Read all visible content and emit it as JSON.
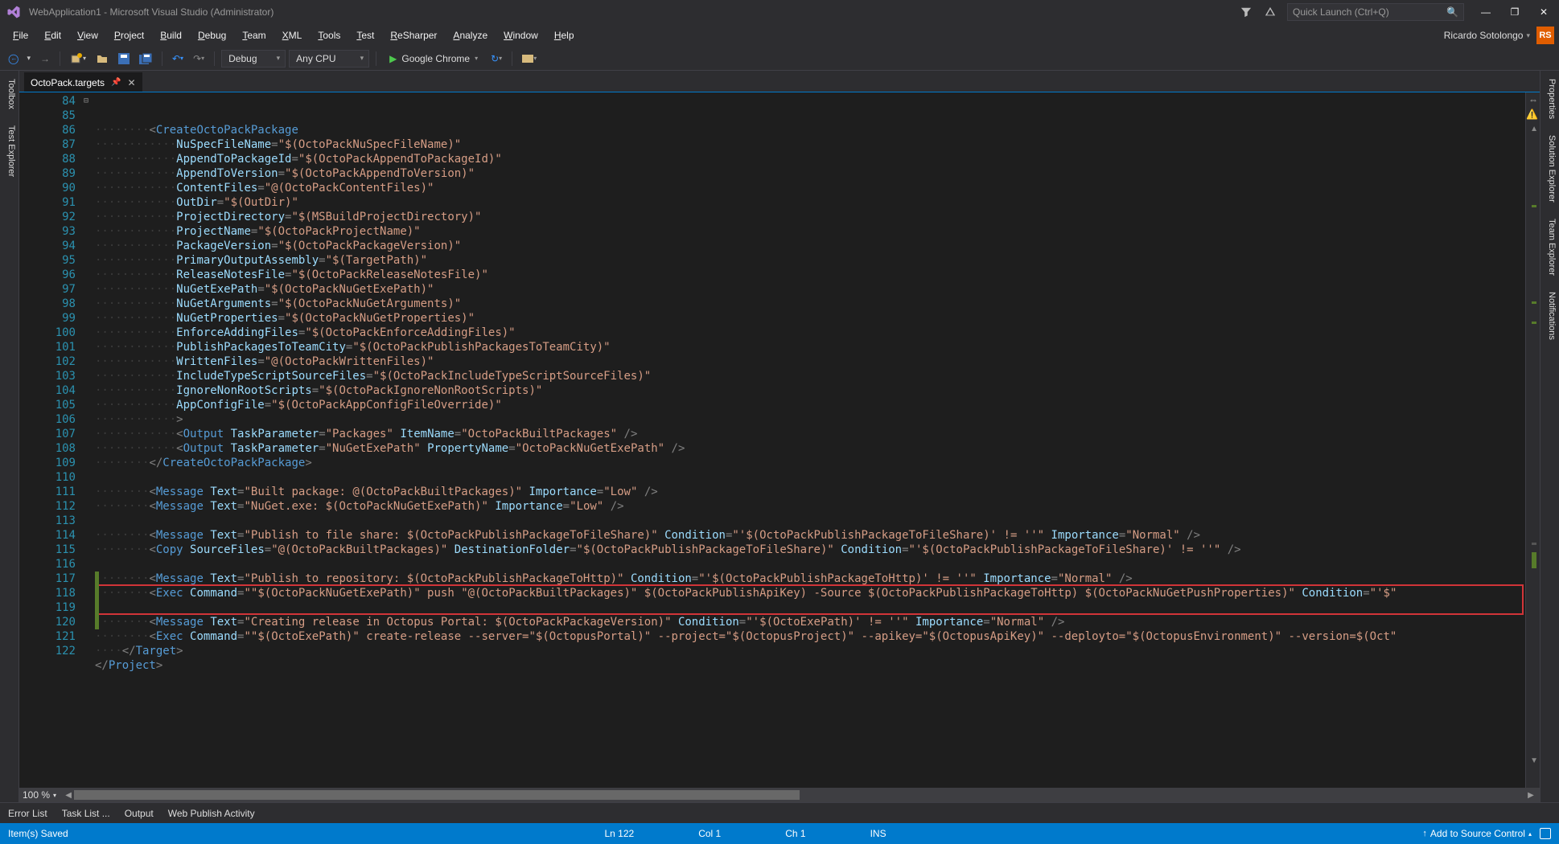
{
  "title": "WebApplication1 - Microsoft Visual Studio  (Administrator)",
  "quick_launch_placeholder": "Quick Launch (Ctrl+Q)",
  "menus": [
    "File",
    "Edit",
    "View",
    "Project",
    "Build",
    "Debug",
    "Team",
    "XML",
    "Tools",
    "Test",
    "ReSharper",
    "Analyze",
    "Window",
    "Help"
  ],
  "user_name": "Ricardo Sotolongo",
  "user_initials": "RS",
  "toolbar": {
    "config": "Debug",
    "platform": "Any CPU",
    "start_label": "Google Chrome"
  },
  "left_tabs": [
    "Toolbox",
    "Test Explorer"
  ],
  "right_tabs": [
    "Properties",
    "Solution Explorer",
    "Team Explorer",
    "Notifications"
  ],
  "doc_tab": "OctoPack.targets",
  "zoom": "100 %",
  "bottom_tabs": [
    "Error List",
    "Task List ...",
    "Output",
    "Web Publish Activity"
  ],
  "status": {
    "left": "Item(s) Saved",
    "ln": "Ln 122",
    "col": "Col 1",
    "ch": "Ch 1",
    "ins": "INS",
    "scc": "Add to Source Control"
  },
  "line_start": 84,
  "code_lines": [
    {
      "indent": 2,
      "type": "open_partial",
      "el": "CreateOctoPackPackage"
    },
    {
      "indent": 3,
      "type": "attr",
      "name": "NuSpecFileName",
      "val": "$(OctoPackNuSpecFileName)"
    },
    {
      "indent": 3,
      "type": "attr",
      "name": "AppendToPackageId",
      "val": "$(OctoPackAppendToPackageId)"
    },
    {
      "indent": 3,
      "type": "attr",
      "name": "AppendToVersion",
      "val": "$(OctoPackAppendToVersion)"
    },
    {
      "indent": 3,
      "type": "attr",
      "name": "ContentFiles",
      "val": "@(OctoPackContentFiles)"
    },
    {
      "indent": 3,
      "type": "attr",
      "name": "OutDir",
      "val": "$(OutDir)"
    },
    {
      "indent": 3,
      "type": "attr",
      "name": "ProjectDirectory",
      "val": "$(MSBuildProjectDirectory)"
    },
    {
      "indent": 3,
      "type": "attr",
      "name": "ProjectName",
      "val": "$(OctoPackProjectName)"
    },
    {
      "indent": 3,
      "type": "attr",
      "name": "PackageVersion",
      "val": "$(OctoPackPackageVersion)"
    },
    {
      "indent": 3,
      "type": "attr",
      "name": "PrimaryOutputAssembly",
      "val": "$(TargetPath)"
    },
    {
      "indent": 3,
      "type": "attr",
      "name": "ReleaseNotesFile",
      "val": "$(OctoPackReleaseNotesFile)"
    },
    {
      "indent": 3,
      "type": "attr",
      "name": "NuGetExePath",
      "val": "$(OctoPackNuGetExePath)"
    },
    {
      "indent": 3,
      "type": "attr",
      "name": "NuGetArguments",
      "val": "$(OctoPackNuGetArguments)"
    },
    {
      "indent": 3,
      "type": "attr",
      "name": "NuGetProperties",
      "val": "$(OctoPackNuGetProperties)"
    },
    {
      "indent": 3,
      "type": "attr",
      "name": "EnforceAddingFiles",
      "val": "$(OctoPackEnforceAddingFiles)"
    },
    {
      "indent": 3,
      "type": "attr",
      "name": "PublishPackagesToTeamCity",
      "val": "$(OctoPackPublishPackagesToTeamCity)"
    },
    {
      "indent": 3,
      "type": "attr",
      "name": "WrittenFiles",
      "val": "@(OctoPackWrittenFiles)"
    },
    {
      "indent": 3,
      "type": "attr",
      "name": "IncludeTypeScriptSourceFiles",
      "val": "$(OctoPackIncludeTypeScriptSourceFiles)"
    },
    {
      "indent": 3,
      "type": "attr",
      "name": "IgnoreNonRootScripts",
      "val": "$(OctoPackIgnoreNonRootScripts)"
    },
    {
      "indent": 3,
      "type": "attr",
      "name": "AppConfigFile",
      "val": "$(OctoPackAppConfigFileOverride)"
    },
    {
      "indent": 3,
      "type": "close_angle"
    },
    {
      "indent": 3,
      "type": "tag",
      "el": "Output",
      "attrs": [
        [
          "TaskParameter",
          "Packages"
        ],
        [
          "ItemName",
          "OctoPackBuiltPackages"
        ]
      ],
      "self": true
    },
    {
      "indent": 3,
      "type": "tag",
      "el": "Output",
      "attrs": [
        [
          "TaskParameter",
          "NuGetExePath"
        ],
        [
          "PropertyName",
          "OctoPackNuGetExePath"
        ]
      ],
      "self": true
    },
    {
      "indent": 2,
      "type": "end",
      "el": "CreateOctoPackPackage"
    },
    {
      "indent": 0,
      "type": "blank"
    },
    {
      "indent": 2,
      "type": "tag",
      "el": "Message",
      "attrs": [
        [
          "Text",
          "Built package: @(OctoPackBuiltPackages)"
        ],
        [
          "Importance",
          "Low"
        ]
      ],
      "self": true
    },
    {
      "indent": 2,
      "type": "tag",
      "el": "Message",
      "attrs": [
        [
          "Text",
          "NuGet.exe: $(OctoPackNuGetExePath)"
        ],
        [
          "Importance",
          "Low"
        ]
      ],
      "self": true
    },
    {
      "indent": 0,
      "type": "blank"
    },
    {
      "indent": 2,
      "type": "tag",
      "el": "Message",
      "attrs": [
        [
          "Text",
          "Publish to file share: $(OctoPackPublishPackageToFileShare)"
        ],
        [
          "Condition",
          "'$(OctoPackPublishPackageToFileShare)' != ''"
        ],
        [
          "Importance",
          "Normal"
        ]
      ],
      "self": true
    },
    {
      "indent": 2,
      "type": "tag",
      "el": "Copy",
      "attrs": [
        [
          "SourceFiles",
          "@(OctoPackBuiltPackages)"
        ],
        [
          "DestinationFolder",
          "$(OctoPackPublishPackageToFileShare)"
        ],
        [
          "Condition",
          "'$(OctoPackPublishPackageToFileShare)' != ''"
        ]
      ],
      "self": true
    },
    {
      "indent": 0,
      "type": "blank"
    },
    {
      "indent": 2,
      "type": "tag",
      "el": "Message",
      "attrs": [
        [
          "Text",
          "Publish to repository: $(OctoPackPublishPackageToHttp)"
        ],
        [
          "Condition",
          "'$(OctoPackPublishPackageToHttp)' != ''"
        ],
        [
          "Importance",
          "Normal"
        ]
      ],
      "self": true
    },
    {
      "indent": 2,
      "type": "tag",
      "el": "Exec",
      "attrs": [
        [
          "Command",
          "\"$(OctoPackNuGetExePath)\" push \"@(OctoPackBuiltPackages)\" $(OctoPackPublishApiKey) -Source $(OctoPackPublishPackageToHttp) $(OctoPackNuGetPushProperties)"
        ],
        [
          "Condition",
          "'$"
        ]
      ],
      "self": false,
      "trunc": true
    },
    {
      "indent": 0,
      "type": "blank"
    },
    {
      "indent": 2,
      "type": "tag",
      "el": "Message",
      "attrs": [
        [
          "Text",
          "Creating release in Octopus Portal: $(OctoPackPackageVersion)"
        ],
        [
          "Condition",
          "'$(OctoExePath)' != ''"
        ],
        [
          "Importance",
          "Normal"
        ]
      ],
      "self": true
    },
    {
      "indent": 2,
      "type": "tag",
      "el": "Exec",
      "attrs": [
        [
          "Command",
          "\"$(OctoExePath)\" create-release --server=\"$(OctopusPortal)\" --project=\"$(OctopusProject)\" --apikey=\"$(OctopusApiKey)\" --deployto=\"$(OctopusEnvironment)\" --version=$(Oct"
        ]
      ],
      "self": false,
      "trunc": true
    },
    {
      "indent": 1,
      "type": "end",
      "el": "Target"
    },
    {
      "indent": 0,
      "type": "end",
      "el": "Project"
    },
    {
      "indent": 0,
      "type": "empty_caret"
    }
  ],
  "highlight_lines": [
    118,
    119
  ],
  "change_bar_lines": [
    [
      117,
      120
    ]
  ]
}
